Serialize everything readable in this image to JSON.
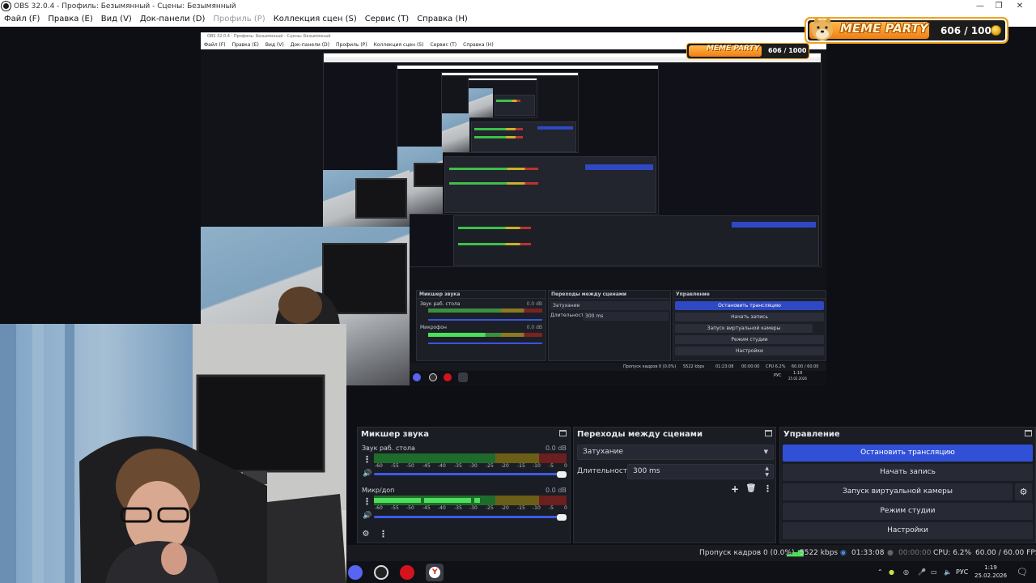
{
  "window": {
    "title": "OBS 32.0.4 - Профиль: Безымянный - Сцены: Безымянный",
    "minimize": "—",
    "maximize": "❐",
    "close": "✕"
  },
  "menu": [
    {
      "label": "Файл (F)",
      "enabled": true
    },
    {
      "label": "Правка (E)",
      "enabled": true
    },
    {
      "label": "Вид (V)",
      "enabled": true
    },
    {
      "label": "Док-панели (D)",
      "enabled": true
    },
    {
      "label": "Профиль (P)",
      "enabled": false
    },
    {
      "label": "Коллекция сцен (S)",
      "enabled": true
    },
    {
      "label": "Сервис (T)",
      "enabled": true
    },
    {
      "label": "Справка (H)",
      "enabled": true
    }
  ],
  "overlay": {
    "title": "MEME PARTY",
    "count": "606 / 1000"
  },
  "mixer": {
    "title": "Микшер звука",
    "channels": [
      {
        "name": "Звук раб. стола",
        "db": "0.0 dB",
        "level": 0.0
      },
      {
        "name": "Микр/доп",
        "db": "0.0 dB",
        "level": 0.55
      }
    ],
    "ticks": [
      "-60",
      "-55",
      "-50",
      "-45",
      "-40",
      "-35",
      "-30",
      "-25",
      "-20",
      "-15",
      "-10",
      "-5",
      "0"
    ]
  },
  "transitions": {
    "title": "Переходы между сценами",
    "selected": "Затухание",
    "duration_label": "Длительность",
    "duration_value": "300 ms"
  },
  "controls": {
    "title": "Управление",
    "stop_stream": "Остановить трансляцию",
    "start_record": "Начать запись",
    "virtual_cam": "Запуск виртуальной камеры",
    "studio_mode": "Режим студии",
    "settings": "Настройки"
  },
  "status": {
    "dropped": "Пропуск кадров 0 (0.0%)",
    "bitrate": "5522 kbps",
    "stream_time": "01:33:08",
    "rec_time": "00:00:00",
    "cpu": "CPU: 6.2%",
    "fps": "60.00 / 60.00 FPS"
  },
  "taskbar": {
    "lang": "РУС",
    "time": "1:19",
    "date": "25.02.2026"
  },
  "inner": {
    "menu": [
      "Файл (F)",
      "Правка (E)",
      "Вид (V)",
      "Док-панели (D)",
      "Профиль (P)",
      "Коллекция сцен (S)",
      "Сервис (T)",
      "Справка (H)"
    ],
    "title": "OBS 32.0.4 - Профиль: Безымянный - Сцены: Безымянный",
    "mixer_title": "Микшер звука",
    "trans_title": "Переходы между сценами",
    "ctrl_title": "Управление",
    "ch1": "Звук раб. стола",
    "ch2": "Микрофон",
    "db": "0.0 dB",
    "fade": "Затухание",
    "dur_label": "Длительность",
    "dur": "300 ms",
    "stop": "Остановить трансляцию",
    "rec": "Начать запись",
    "vcam": "Запуск виртуальной камеры",
    "studio": "Режим студии",
    "settings": "Настройки",
    "dropped": "Пропуск кадров 0 (0.0%)",
    "bitrate": "5522 kbps",
    "time1": "01:23:08",
    "time2": "00:00:00",
    "cpu": "CPU 6.2%",
    "fps": "60.00 / 60.00 FPS",
    "count": "606 / 1000",
    "lang": "РУС",
    "clock": "1:19",
    "date": "25.02.2026"
  }
}
